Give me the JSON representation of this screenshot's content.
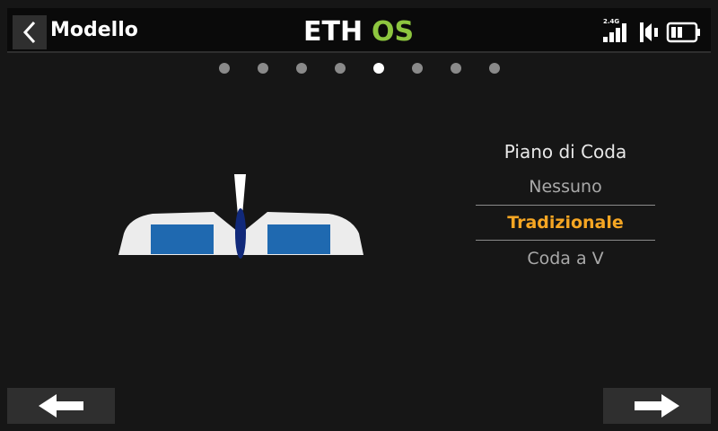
{
  "header": {
    "title": "Modello",
    "logo_text": "ETHOS",
    "signal_band": "2.4G",
    "icons": [
      "back-chevron-icon",
      "signal-icon",
      "speaker-icon",
      "battery-icon"
    ]
  },
  "pager": {
    "count": 8,
    "active_index": 4
  },
  "tail_selector": {
    "heading": "Piano di Coda",
    "options": [
      "Nessuno",
      "Tradizionale",
      "Coda a V"
    ],
    "selected": "Tradizionale"
  },
  "nav": {
    "prev_icon": "arrow-left-icon",
    "next_icon": "arrow-right-icon"
  },
  "colors": {
    "accent": "#f6a623",
    "logo_green": "#8dc63f",
    "elevator_blue": "#1f69b0",
    "fin_blue": "#11297a"
  }
}
